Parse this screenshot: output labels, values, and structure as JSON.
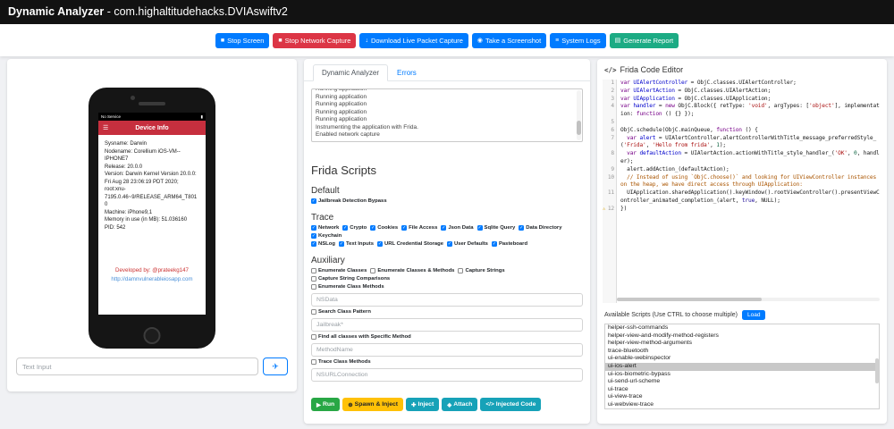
{
  "header": {
    "title_bold": "Dynamic Analyzer",
    "title_rest": " - com.highaltitudehacks.DVIAswiftv2"
  },
  "toolbar": {
    "buttons": [
      {
        "label": "Stop Screen",
        "icon": "stop-icon",
        "glyph": "■",
        "color": "#007bff"
      },
      {
        "label": "Stop Network Capture",
        "icon": "stop-icon",
        "glyph": "■",
        "color": "#dc3545"
      },
      {
        "label": "Download Live Packet Capture",
        "icon": "download-icon",
        "glyph": "↓",
        "color": "#007bff"
      },
      {
        "label": "Take a Screenshot",
        "icon": "camera-icon",
        "glyph": "◉",
        "color": "#007bff"
      },
      {
        "label": "System Logs",
        "icon": "logs-icon",
        "glyph": "≡",
        "color": "#007bff"
      },
      {
        "label": "Generate Report",
        "icon": "report-icon",
        "glyph": "▤",
        "color": "#1cab84"
      }
    ]
  },
  "device": {
    "status_left": "No Service",
    "status_battery_glyph": "▮",
    "menu_glyph": "☰",
    "nav_title": "Device Info",
    "info_lines": [
      "Sysname: Darwin",
      "Nodename: Corellium iOS-VM--IPHONE7",
      "Release: 20.0.0",
      "Version: Darwin Kernel Version 20.0.0: Fri Aug 28 23:06:19 PDT 2020; root:xnu-7195.0.46~9/RELEASE_ARM64_T8010",
      "Machine: iPhone9,1",
      "Memory in use (in MB): 51.036160",
      "PID: 542"
    ],
    "developed_by": "Developed by: @prateekg147",
    "website": "http://damnvulnerableiosapp.com",
    "input_placeholder": "Text Input",
    "send_glyph": "✈"
  },
  "analyzer": {
    "tabs": [
      {
        "label": "Dynamic Analyzer"
      },
      {
        "label": "Errors"
      }
    ],
    "log_lines": [
      "Running application",
      "Running application",
      "Running application",
      "Running application",
      "Running application",
      "Instrumenting the application with Frida.",
      "Enabled network capture"
    ],
    "section_title": "Frida Scripts",
    "check_glyph": "✓",
    "groups": [
      {
        "title": "Default",
        "rows": [
          [
            {
              "label": "Jailbreak Detection Bypass",
              "checked": true
            }
          ]
        ]
      },
      {
        "title": "Trace",
        "rows": [
          [
            {
              "label": "Network",
              "checked": true
            },
            {
              "label": "Crypto",
              "checked": true
            },
            {
              "label": "Cookies",
              "checked": true
            },
            {
              "label": "File Access",
              "checked": true
            },
            {
              "label": "Json Data",
              "checked": true
            },
            {
              "label": "Sqlite Query",
              "checked": true
            },
            {
              "label": "Data Directory",
              "checked": true
            },
            {
              "label": "Keychain",
              "checked": true
            }
          ],
          [
            {
              "label": "NSLog",
              "checked": true
            },
            {
              "label": "Text Inputs",
              "checked": true
            },
            {
              "label": "URL Credential Storage",
              "checked": true
            },
            {
              "label": "User Defaults",
              "checked": true
            },
            {
              "label": "Pasteboard",
              "checked": true
            }
          ]
        ]
      },
      {
        "title": "Auxiliary",
        "rows": [
          [
            {
              "label": "Enumerate Classes",
              "checked": false
            },
            {
              "label": "Enumerate Classes & Methods",
              "checked": false
            },
            {
              "label": "Capture Strings",
              "checked": false
            },
            {
              "label": "Capture String Comparisons",
              "checked": false
            }
          ],
          [
            {
              "label": "Enumerate Class Methods",
              "checked": false
            }
          ]
        ]
      }
    ],
    "aux_fields": [
      {
        "type": "input",
        "placeholder": "NSData"
      },
      {
        "type": "checkbox",
        "label": "Search Class Pattern"
      },
      {
        "type": "input",
        "placeholder": "Jailbreak*"
      },
      {
        "type": "checkbox",
        "label": "Find all classes with Specific Method"
      },
      {
        "type": "input",
        "placeholder": "MethodName"
      },
      {
        "type": "checkbox",
        "label": "Trace Class Methods"
      },
      {
        "type": "input",
        "placeholder": "NSURLConnection"
      }
    ],
    "action_buttons": [
      {
        "label": "Run",
        "icon": "play-icon",
        "glyph": "▶",
        "color": "#28a745",
        "text": "#fff"
      },
      {
        "label": "Spawn & Inject",
        "icon": "spawn-icon",
        "glyph": "⊕",
        "color": "#ffc107",
        "text": "#212529"
      },
      {
        "label": "Inject",
        "icon": "inject-icon",
        "glyph": "✚",
        "color": "#17a2b8",
        "text": "#fff"
      },
      {
        "label": "Attach",
        "icon": "attach-icon",
        "glyph": "◈",
        "color": "#17a2b8",
        "text": "#fff"
      },
      {
        "label": "Injected Code",
        "icon": "code-icon",
        "glyph": "</>",
        "color": "#17a2b8",
        "text": "#fff"
      }
    ]
  },
  "editor": {
    "title": "Frida Code Editor",
    "icon_glyph": "</>",
    "warning_glyph": "⚠",
    "warning_line": 12,
    "lines": [
      {
        "n": 1,
        "tokens": [
          [
            "k",
            "var"
          ],
          [
            "p",
            " "
          ],
          [
            "d",
            "UIAlertController"
          ],
          [
            "p",
            " = ObjC.classes.UIAlertController;"
          ]
        ]
      },
      {
        "n": 2,
        "tokens": [
          [
            "k",
            "var"
          ],
          [
            "p",
            " "
          ],
          [
            "d",
            "UIAlertAction"
          ],
          [
            "p",
            " = ObjC.classes.UIAlertAction;"
          ]
        ]
      },
      {
        "n": 3,
        "tokens": [
          [
            "k",
            "var"
          ],
          [
            "p",
            " "
          ],
          [
            "d",
            "UIApplication"
          ],
          [
            "p",
            " = ObjC.classes.UIApplication;"
          ]
        ]
      },
      {
        "n": 4,
        "tokens": [
          [
            "k",
            "var"
          ],
          [
            "p",
            " "
          ],
          [
            "d",
            "handler"
          ],
          [
            "p",
            " = "
          ],
          [
            "k",
            "new"
          ],
          [
            "p",
            " ObjC.Block({ retType: "
          ],
          [
            "s",
            "'void'"
          ],
          [
            "p",
            ", argTypes: ["
          ],
          [
            "s",
            "'object'"
          ],
          [
            "p",
            "], implementation: "
          ],
          [
            "k",
            "function"
          ],
          [
            "p",
            " () {} });"
          ]
        ]
      },
      {
        "n": 5,
        "tokens": []
      },
      {
        "n": 6,
        "tokens": [
          [
            "p",
            "ObjC.schedule(ObjC.mainQueue, "
          ],
          [
            "k",
            "function"
          ],
          [
            "p",
            " () {"
          ]
        ]
      },
      {
        "n": 7,
        "tokens": [
          [
            "p",
            "  "
          ],
          [
            "k",
            "var"
          ],
          [
            "p",
            " "
          ],
          [
            "d",
            "alert"
          ],
          [
            "p",
            " = UIAlertController.alertControllerWithTitle_message_preferredStyle_("
          ],
          [
            "s",
            "'Frida'"
          ],
          [
            "p",
            ", "
          ],
          [
            "s",
            "'Hello from frida'"
          ],
          [
            "p",
            ", "
          ],
          [
            "n2",
            "1"
          ],
          [
            "p",
            ");"
          ]
        ]
      },
      {
        "n": 8,
        "tokens": [
          [
            "p",
            "  "
          ],
          [
            "k",
            "var"
          ],
          [
            "p",
            " "
          ],
          [
            "d",
            "defaultAction"
          ],
          [
            "p",
            " = UIAlertAction.actionWithTitle_style_handler_("
          ],
          [
            "s",
            "'OK'"
          ],
          [
            "p",
            ", "
          ],
          [
            "n2",
            "0"
          ],
          [
            "p",
            ", handler);"
          ]
        ]
      },
      {
        "n": 9,
        "tokens": [
          [
            "p",
            "  alert.addAction_(defaultAction);"
          ]
        ]
      },
      {
        "n": 10,
        "tokens": [
          [
            "p",
            "  "
          ],
          [
            "c",
            "// Instead of using `ObjC.choose()` and looking for UIViewController instances on the heap, we have direct access through UIApplication:"
          ]
        ]
      },
      {
        "n": 11,
        "tokens": [
          [
            "p",
            "  UIApplication.sharedApplication().keyWindow().rootViewController().presentViewController_animated_completion_(alert, "
          ],
          [
            "a",
            "true"
          ],
          [
            "p",
            ", NULL);"
          ]
        ]
      },
      {
        "n": 12,
        "tokens": [
          [
            "p",
            "})"
          ]
        ]
      }
    ]
  },
  "scripts": {
    "label": "Available Scripts (Use CTRL to choose multiple)",
    "load_label": "Load",
    "selected": "ui-ios-alert",
    "items": [
      "helper-ssh-commands",
      "helper-view-and-modify-method-registers",
      "helper-view-method-arguments",
      "trace-bluetooth",
      "ui-enable-webinspector",
      "ui-ios-alert",
      "ui-ios-biometric-bypass",
      "ui-send-url-scheme",
      "ui-trace",
      "ui-view-trace",
      "ui-webview-trace"
    ]
  }
}
